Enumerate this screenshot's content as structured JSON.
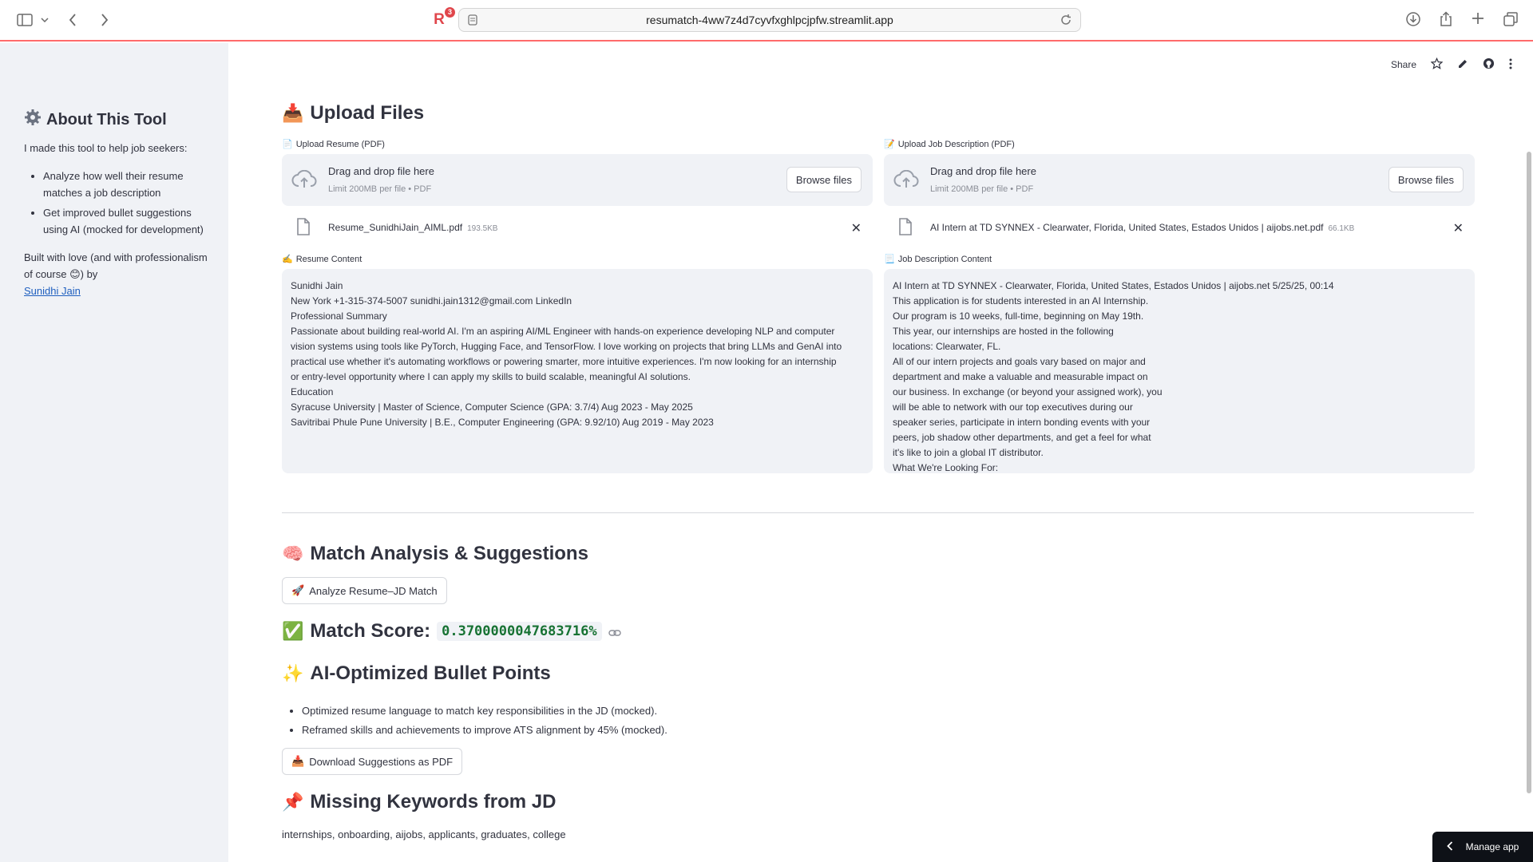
{
  "browser": {
    "url": "resumatch-4ww7z4d7cyvfxghlpcjpfw.streamlit.app",
    "extension_badge": "3",
    "extension_letter": "R"
  },
  "sidebar": {
    "title": "About This Tool",
    "intro": "I made this tool to help job seekers:",
    "items": [
      "Analyze how well their resume matches a job description",
      "Get improved bullet suggestions using AI (mocked for development)"
    ],
    "footer_text": "Built with love (and with professionalism of course 😊) by",
    "author_link": "Sunidhi Jain"
  },
  "toolbar": {
    "share_label": "Share"
  },
  "upload": {
    "heading": "Upload Files",
    "resume": {
      "label": "Upload Resume (PDF)",
      "drop_title": "Drag and drop file here",
      "drop_sub": "Limit 200MB per file • PDF",
      "browse_label": "Browse files",
      "file_name": "Resume_SunidhiJain_AIML.pdf",
      "file_size": "193.5KB",
      "content_label": "Resume Content",
      "content": "Sunidhi Jain\nNew York +1-315-374-5007 sunidhi.jain1312@gmail.com LinkedIn\nProfessional Summary\nPassionate about building real-world AI. I'm an aspiring AI/ML Engineer with hands-on experience developing NLP and computer\nvision systems using tools like PyTorch, Hugging Face, and TensorFlow. I love working on projects that bring LLMs and GenAI into\npractical use whether it's automating workflows or powering smarter, more intuitive experiences. I'm now looking for an internship\nor entry-level opportunity where I can apply my skills to build scalable, meaningful AI solutions.\nEducation\nSyracuse University | Master of Science, Computer Science (GPA: 3.7/4) Aug 2023 - May 2025\nSavitribai Phule Pune University | B.E., Computer Engineering (GPA: 9.92/10) Aug 2019 - May 2023"
    },
    "jd": {
      "label": "Upload Job Description (PDF)",
      "drop_title": "Drag and drop file here",
      "drop_sub": "Limit 200MB per file • PDF",
      "browse_label": "Browse files",
      "file_name": "AI Intern at TD SYNNEX - Clearwater, Florida, United States, Estados Unidos | aijobs.net.pdf",
      "file_size": "66.1KB",
      "content_label": "Job Description Content",
      "content": "AI Intern at TD SYNNEX - Clearwater, Florida, United States, Estados Unidos | aijobs.net 5/25/25, 00:14\nThis application is for students interested in an AI Internship.\nOur program is 10 weeks, full-time, beginning on May 19th.\nThis year, our internships are hosted in the following\nlocations: Clearwater, FL.\nAll of our intern projects and goals vary based on major and\ndepartment and make a valuable and measurable impact on\nour business. In exchange (or beyond your assigned work), you\nwill be able to network with our top executives during our\nspeaker series, participate in intern bonding events with your\npeers, job shadow other departments, and get a feel for what\nit's like to join a global IT distributor.\nWhat We're Looking For:"
    }
  },
  "analysis": {
    "heading": "Match Analysis & Suggestions",
    "analyze_button": "Analyze Resume–JD Match",
    "score_label": "Match Score:",
    "score_value": "0.3700000047683716%",
    "bullets_heading": "AI-Optimized Bullet Points",
    "bullets": [
      "Optimized resume language to match key responsibilities in the JD (mocked).",
      "Reframed skills and achievements to improve ATS alignment by 45% (mocked)."
    ],
    "download_button": "Download Suggestions as PDF",
    "keywords_heading": "Missing Keywords from JD",
    "keywords": "internships, onboarding, aijobs, applicants, graduates, college"
  },
  "manage_app": "Manage app"
}
